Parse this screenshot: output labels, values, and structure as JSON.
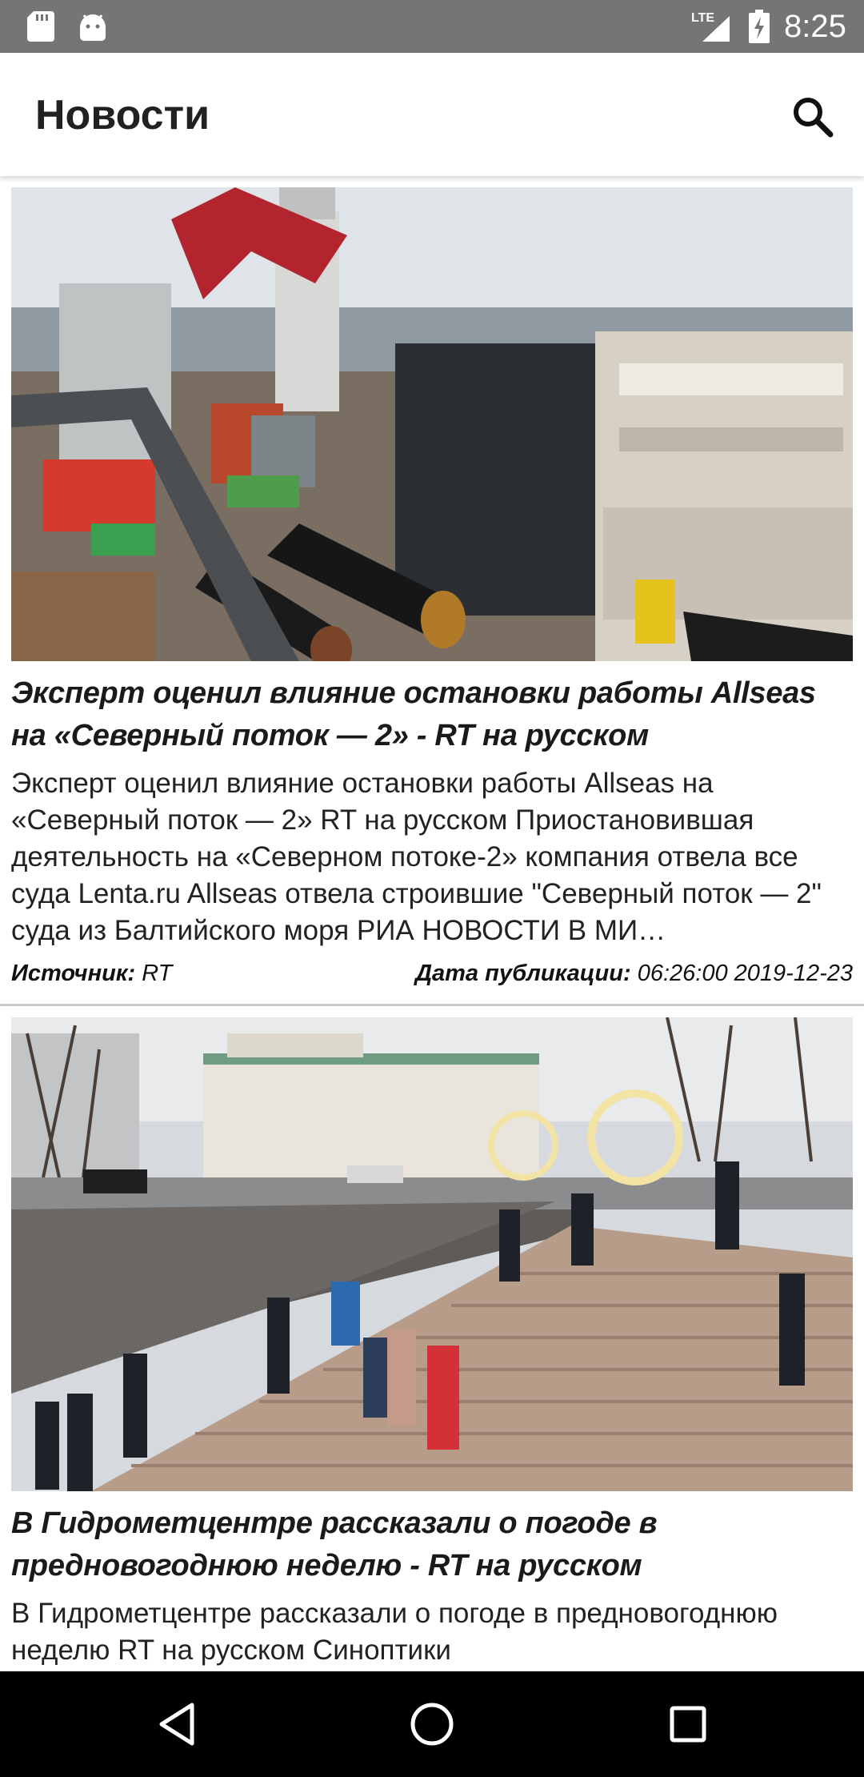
{
  "status_bar": {
    "network": "LTE",
    "time": "8:25"
  },
  "app_bar": {
    "title": "Новости",
    "search_icon": "search-icon"
  },
  "articles": [
    {
      "title": "Эксперт оценил влияние остановки работы Allseas на «Северный поток — 2» - RT на русском",
      "description": "Эксперт оценил влияние остановки работы Allseas на «Северный поток — 2» RT на русском Приостановившая деятельность на «Северном потоке-2» компания отвела все суда Lenta.ru Allseas отвела строившие \"Северный поток — 2\" суда из Балтийского моря РИА НОВОСТИ В МИ…",
      "source_label": "Источник:",
      "source_value": "RT",
      "date_label": "Дата публикации:",
      "date_value": "06:26:00 2019-12-23"
    },
    {
      "title": "В Гидрометцентре рассказали о погоде в предновогоднюю неделю - RT на русском",
      "description": "В Гидрометцентре рассказали о погоде в предновогоднюю неделю RT на русском Синоптики"
    }
  ],
  "nav_bar": {
    "back_icon": "back-triangle-icon",
    "home_icon": "home-circle-icon",
    "recents_icon": "recents-square-icon"
  },
  "colors": {
    "status_bar": "#757575",
    "app_bar": "#ffffff",
    "nav_bar": "#000000",
    "divider": "#c8c8c8"
  }
}
